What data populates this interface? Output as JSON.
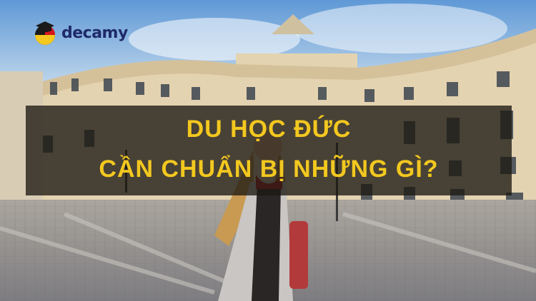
{
  "logo": {
    "text": "decamy",
    "icon": "graduation-cap-flag-icon"
  },
  "headline": {
    "line1": "DU HỌC ĐỨC",
    "line2": "CẦN CHUẨN BỊ NHỮNG GÌ?"
  },
  "colors": {
    "headline": "#f3c81f",
    "overlay": "#1c1812",
    "logo_text": "#1f2a6b"
  }
}
